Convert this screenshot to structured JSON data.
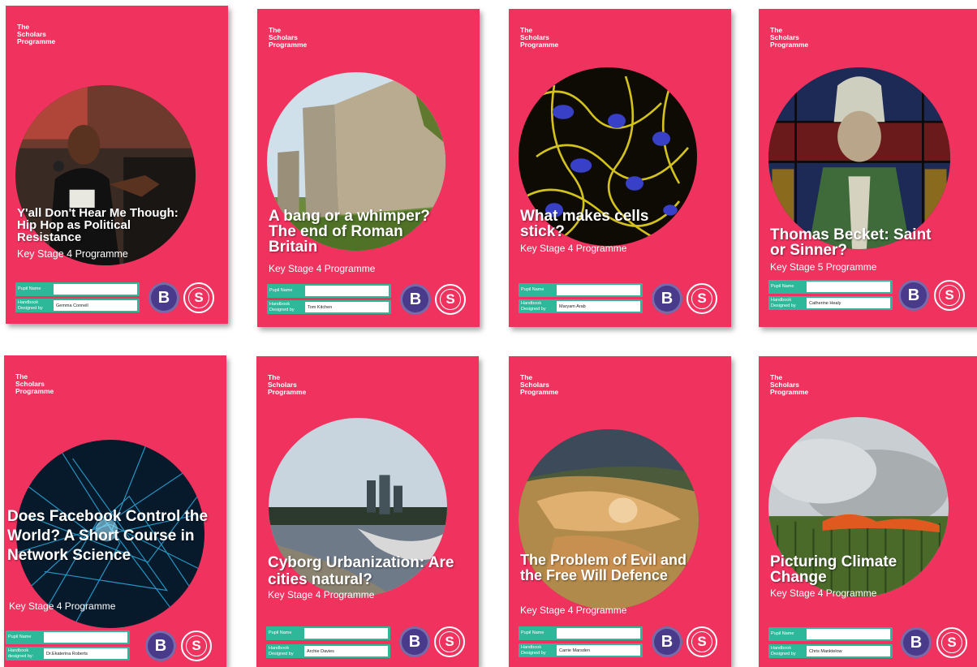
{
  "brand": "The\nScholars\nProgramme",
  "colors": {
    "cover": "#f0325f",
    "form": "#2eb89a",
    "bLogo": "#4a3a8c"
  },
  "pupil_label": "Pupil Name",
  "logos": {
    "b": "B",
    "s": "S"
  },
  "covers": [
    {
      "title": "Y'all Don't Hear Me Though: Hip Hop as Political Resistance",
      "stage": "Key Stage 4 Programme",
      "designer_label": "Handbook\nDesigned by",
      "designer": "Gemma Connell",
      "image": "person-rapping-with-microphone"
    },
    {
      "title": "A bang or a whimper? The end of Roman Britain",
      "stage": "Key Stage 4 Programme",
      "designer_label": "Handbook\nDesigned by",
      "designer": "Tom Kitchen",
      "image": "ruined-roman-stone-wall"
    },
    {
      "title": "What makes cells stick?",
      "stage": "Key Stage 4 Programme",
      "designer_label": "Handbook\nDesigned by",
      "designer": "Maryam Arab",
      "image": "fluorescent-cells-micrograph"
    },
    {
      "title": "Thomas Becket: Saint or Sinner?",
      "stage": "Key Stage 5 Programme",
      "designer_label": "Handbook\nDesigned by",
      "designer": "Catherine Healy",
      "image": "stained-glass-saint"
    },
    {
      "title": "Does Facebook Control the World? A Short Course in Network Science",
      "stage": "Key Stage 4 Programme",
      "designer_label": "Handbook\ndesigned by:",
      "designer": "Dr.Ekaterina Roberts",
      "image": "blue-network-web"
    },
    {
      "title": "Cyborg Urbanization: Are cities natural?",
      "stage": "Key Stage 4 Programme",
      "designer_label": "Handbook\nDesigned by",
      "designer": "Archie Davies",
      "image": "river-and-city-skyline"
    },
    {
      "title": "The Problem of Evil and the Free Will Defence",
      "stage": "Key Stage 4 Programme",
      "designer_label": "Handbook\nDesigned by",
      "designer": "Carrie Marsden",
      "image": "painting-of-god-figure"
    },
    {
      "title": "Picturing Climate Change",
      "stage": "Key Stage 4 Programme",
      "designer_label": "Handbook\nDesigned by",
      "designer": "Chris Manktelow",
      "image": "burning-field-smoke"
    }
  ]
}
